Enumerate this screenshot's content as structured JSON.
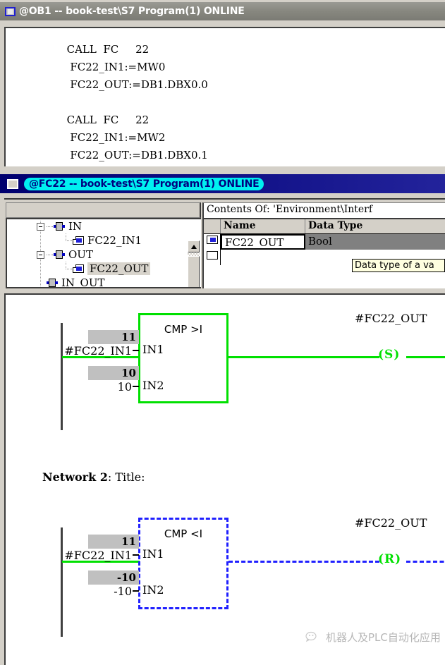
{
  "window1": {
    "title": "@OB1 -- book-test\\S7 Program(1)  ONLINE",
    "icon": "system-menu-icon",
    "code_lines": "      CALL  FC     22\n       FC22_IN1:=MW0\n       FC22_OUT:=DB1.DBX0.0\n\n      CALL  FC     22\n       FC22_IN1:=MW2\n       FC22_OUT:=DB1.DBX0.1"
  },
  "window2": {
    "title": "@FC22 -- book-test\\S7 Program(1)  ONLINE",
    "icon": "system-menu-icon",
    "declaration": {
      "contents_of_label": "Contents Of: 'Environment\\Interf",
      "tree": [
        {
          "label": "IN",
          "level": 0,
          "icon": "block-io-icon",
          "expander": "minus",
          "selected": false
        },
        {
          "label": "FC22_IN1",
          "level": 1,
          "icon": "variable-icon",
          "expander": "none",
          "selected": false
        },
        {
          "label": "OUT",
          "level": 0,
          "icon": "block-io-icon",
          "expander": "minus",
          "selected": false
        },
        {
          "label": "FC22_OUT",
          "level": 1,
          "icon": "variable-icon",
          "expander": "none",
          "selected": true
        },
        {
          "label": "IN_OUT",
          "level": 0,
          "icon": "block-io-icon",
          "expander": "none",
          "selected": false
        }
      ],
      "table": {
        "columns": [
          "",
          "Name",
          "Data Type"
        ],
        "rows": [
          {
            "icon": "variable-icon",
            "name": "FC22_OUT",
            "data_type": "Bool"
          },
          {
            "icon": "new-row-icon",
            "name": "",
            "data_type": ""
          }
        ]
      },
      "tooltip": "Data type of a va"
    },
    "ladder": {
      "networks": [
        {
          "title_prefix": "",
          "title_text": "",
          "block_label": "CMP >I",
          "block_state": "active",
          "in1_value": "11",
          "in1_operand": "#FC22_IN1",
          "in1_pin": "IN1",
          "in2_value": "10",
          "in2_operand": "10",
          "in2_pin": "IN2",
          "coil_name": "#FC22_OUT",
          "coil_symbol": "(S)"
        },
        {
          "title_prefix": "Network 2",
          "title_text": ": Title:",
          "block_label": "CMP <I",
          "block_state": "inactive",
          "in1_value": "11",
          "in1_operand": "#FC22_IN1",
          "in1_pin": "IN1",
          "in2_value": "-10",
          "in2_operand": "-10",
          "in2_pin": "IN2",
          "coil_name": "#FC22_OUT",
          "coil_symbol": "(R)"
        }
      ]
    }
  },
  "watermark": {
    "text": "机器人及PLC自动化应用",
    "icon": "wechat-logo-icon"
  },
  "colors": {
    "active_title": "#000080",
    "inactive_title": "#87877f",
    "title_highlight": "#00f0f0",
    "power_flow": "#00e000",
    "no_flow": "#2020ff",
    "face": "#d4d0c8",
    "value_box": "#c0c0c0",
    "selected_cell": "#808080",
    "tooltip_bg": "#ffffe0"
  }
}
